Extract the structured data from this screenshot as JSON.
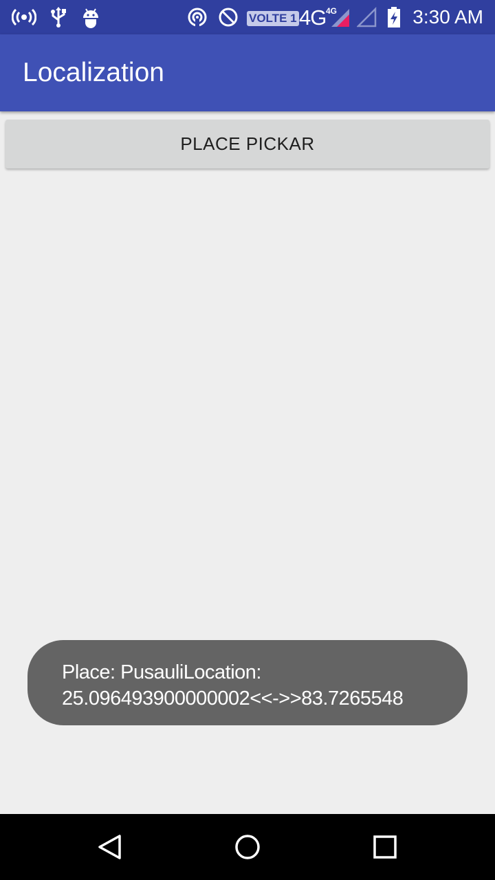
{
  "status_bar": {
    "icons": [
      "hotspot-icon",
      "usb-icon",
      "android-debug-icon",
      "nfc-icon",
      "block-icon"
    ],
    "volte": "VOLTE 1",
    "network": "4G",
    "network_small": "4G",
    "time": "3:30 AM",
    "colors": {
      "background": "#303f9f"
    }
  },
  "app_bar": {
    "title": "Localization",
    "color": "#3f51b5"
  },
  "main": {
    "button_label": "PLACE PICKAR"
  },
  "toast": {
    "line1": "Place: PusauliLocation:",
    "line2": "25.096493900000002<<->>83.7265548"
  },
  "nav_bar": {
    "buttons": [
      "back-icon",
      "home-icon",
      "recents-icon"
    ]
  }
}
